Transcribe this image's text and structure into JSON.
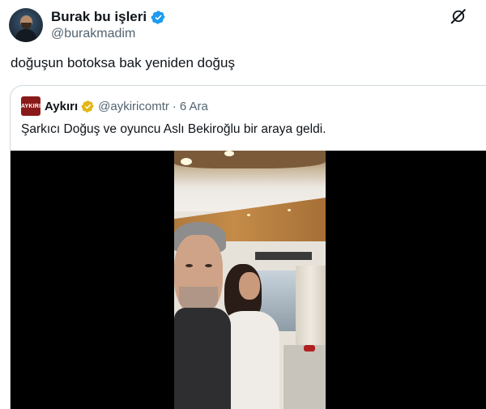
{
  "tweet": {
    "author": {
      "display_name": "Burak bu işleri",
      "handle": "@burakmadim",
      "verified": true
    },
    "text": "doğuşun botoksa bak yeniden doğuş",
    "grok_icon": "grok-icon"
  },
  "quote": {
    "avatar_text": "AYKIRI",
    "display_name": "Aykırı",
    "handle": "@aykiricomtr",
    "separator": "·",
    "date": "6 Ara",
    "text": "Şarkıcı Doğuş ve oyuncu Aslı Bekiroğlu bir araya geldi.",
    "verified_gold": true
  },
  "colors": {
    "verified_blue": "#1d9bf0",
    "verified_gold": "#e2b719",
    "secondary_text": "#536471",
    "quote_avatar_bg": "#8a1a1a"
  }
}
